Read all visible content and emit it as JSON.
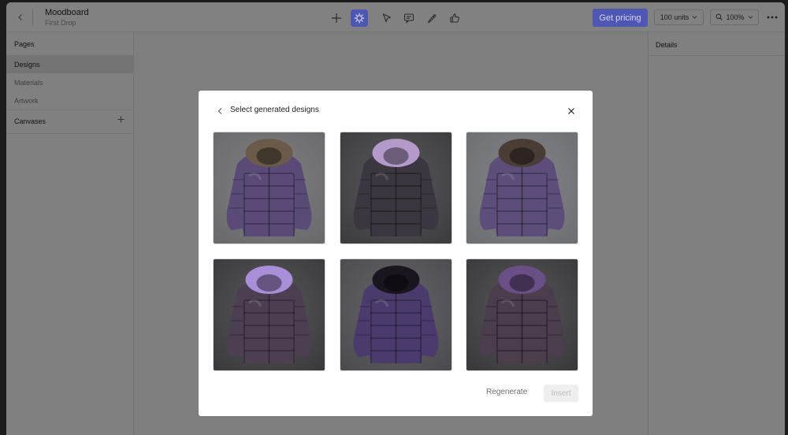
{
  "header": {
    "title": "Moodboard",
    "subtitle": "First Drop",
    "pricing_label": "Get pricing",
    "units_value": "100 units",
    "zoom_value": "100%"
  },
  "left_panel": {
    "pages_heading": "Pages",
    "items": [
      {
        "label": "Designs"
      },
      {
        "label": "Materials"
      },
      {
        "label": "Artwork"
      }
    ],
    "canvases_heading": "Canvases"
  },
  "right_panel": {
    "heading": "Details"
  },
  "dialog": {
    "title": "Select generated designs",
    "regenerate_label": "Regenerate",
    "insert_label": "Insert",
    "designs": [
      {
        "icon": "jacket-image",
        "bg": "#6a6a6c",
        "body": "#5a4a78",
        "fur": "#6a5a4a"
      },
      {
        "icon": "jacket-image",
        "bg": "#3d3d40",
        "body": "#3b3740",
        "fur": "#b39acb"
      },
      {
        "icon": "jacket-image",
        "bg": "#6d6f73",
        "body": "#5c4d7a",
        "fur": "#4a3d36"
      },
      {
        "icon": "jacket-image",
        "bg": "#3b3a3d",
        "body": "#4d3f52",
        "fur": "#a98ed8"
      },
      {
        "icon": "jacket-image",
        "bg": "#4c4c50",
        "body": "#4a3b6c",
        "fur": "#1a1620"
      },
      {
        "icon": "jacket-image",
        "bg": "#3a393c",
        "body": "#4a3d4c",
        "fur": "#6a4f86"
      }
    ]
  },
  "colors": {
    "accent": "#4f57b4",
    "overlay": "#7e7e7e"
  }
}
